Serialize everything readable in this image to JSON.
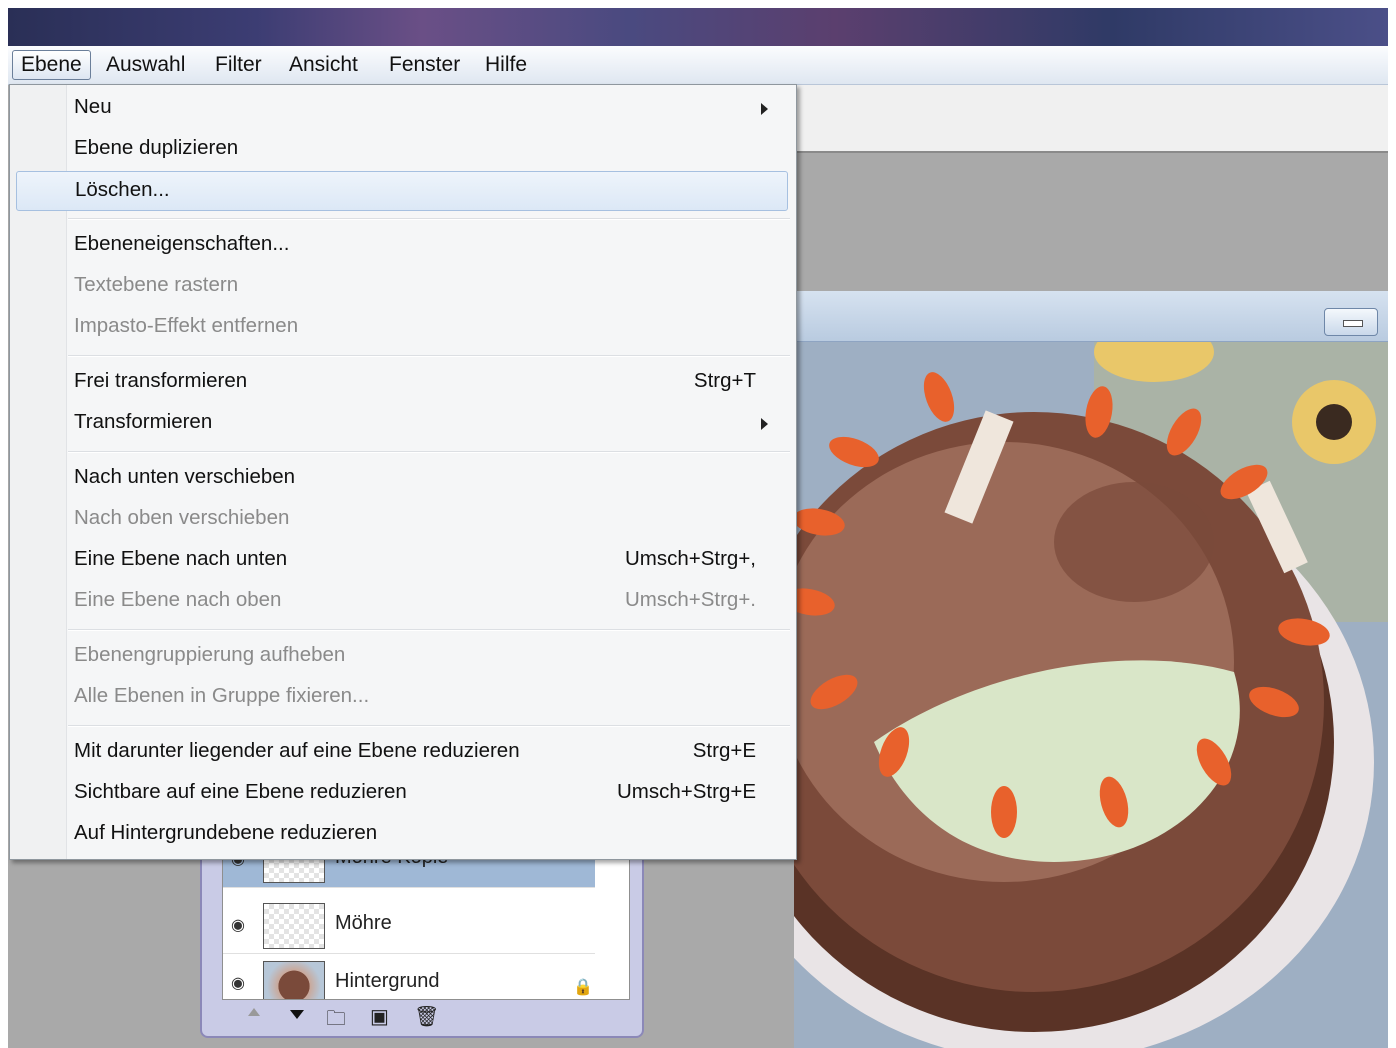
{
  "menubar": {
    "items": [
      "Ebene",
      "Auswahl",
      "Filter",
      "Ansicht",
      "Fenster",
      "Hilfe"
    ]
  },
  "dropdown": {
    "items": [
      {
        "label": "Neu",
        "shortcut": "",
        "submenu": true,
        "enabled": true
      },
      {
        "label": "Ebene duplizieren",
        "shortcut": "",
        "submenu": false,
        "enabled": true
      },
      {
        "label": "Löschen...",
        "shortcut": "",
        "submenu": false,
        "enabled": true,
        "highlighted": true
      },
      {
        "label": "Ebeneneigenschaften...",
        "shortcut": "",
        "submenu": false,
        "enabled": true
      },
      {
        "label": "Textebene rastern",
        "shortcut": "",
        "submenu": false,
        "enabled": false
      },
      {
        "label": "Impasto-Effekt entfernen",
        "shortcut": "",
        "submenu": false,
        "enabled": false
      },
      {
        "label": "Frei transformieren",
        "shortcut": "Strg+T",
        "submenu": false,
        "enabled": true
      },
      {
        "label": "Transformieren",
        "shortcut": "",
        "submenu": true,
        "enabled": true
      },
      {
        "label": "Nach unten verschieben",
        "shortcut": "",
        "submenu": false,
        "enabled": true
      },
      {
        "label": "Nach oben verschieben",
        "shortcut": "",
        "submenu": false,
        "enabled": false
      },
      {
        "label": "Eine Ebene nach unten",
        "shortcut": "Umsch+Strg+,",
        "submenu": false,
        "enabled": true
      },
      {
        "label": "Eine Ebene nach oben",
        "shortcut": "Umsch+Strg+.",
        "submenu": false,
        "enabled": false
      },
      {
        "label": "Ebenengruppierung aufheben",
        "shortcut": "",
        "submenu": false,
        "enabled": false
      },
      {
        "label": "Alle Ebenen in Gruppe fixieren...",
        "shortcut": "",
        "submenu": false,
        "enabled": false
      },
      {
        "label": "Mit darunter liegender auf eine Ebene reduzieren",
        "shortcut": "Strg+E",
        "submenu": false,
        "enabled": true
      },
      {
        "label": "Sichtbare auf eine Ebene reduzieren",
        "shortcut": "Umsch+Strg+E",
        "submenu": false,
        "enabled": true
      },
      {
        "label": "Auf Hintergrundebene reduzieren",
        "shortcut": "",
        "submenu": false,
        "enabled": true
      }
    ]
  },
  "layers": {
    "rows": [
      {
        "name": "Möhre Kopie",
        "selected": true
      },
      {
        "name": "Möhre",
        "selected": false
      },
      {
        "name": "Hintergrund",
        "selected": false,
        "locked": true
      }
    ]
  },
  "icons": {
    "eye": "eye-icon",
    "lock": "lock-icon",
    "new_folder": "folder-icon",
    "new_layer": "new-layer-icon",
    "delete": "trash-icon"
  },
  "colors": {
    "menu_highlight": "#dce8f6",
    "selected_layer": "#9fb8d6",
    "disabled_text": "#8a8a8a"
  }
}
